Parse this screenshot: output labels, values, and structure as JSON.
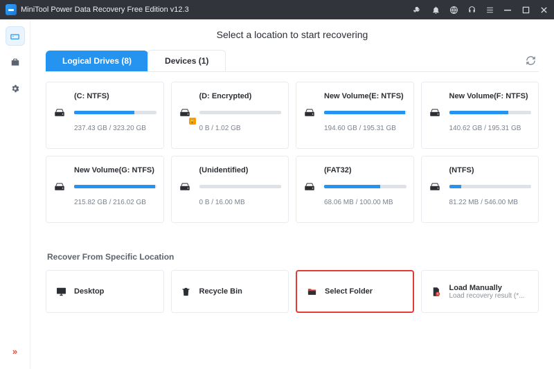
{
  "titlebar": {
    "title": "MiniTool Power Data Recovery Free Edition v12.3"
  },
  "page": {
    "heading": "Select a location to start recovering",
    "section_title": "Recover From Specific Location"
  },
  "tabs": {
    "logical": "Logical Drives (8)",
    "devices": "Devices (1)"
  },
  "drives": [
    {
      "name": "(C: NTFS)",
      "size": "237.43 GB / 323.20 GB",
      "pct": 73,
      "locked": false
    },
    {
      "name": "(D: Encrypted)",
      "size": "0 B / 1.02 GB",
      "pct": 0,
      "locked": true
    },
    {
      "name": "New Volume(E: NTFS)",
      "size": "194.60 GB / 195.31 GB",
      "pct": 99,
      "locked": false
    },
    {
      "name": "New Volume(F: NTFS)",
      "size": "140.62 GB / 195.31 GB",
      "pct": 72,
      "locked": false
    },
    {
      "name": "New Volume(G: NTFS)",
      "size": "215.82 GB / 216.02 GB",
      "pct": 99,
      "locked": false
    },
    {
      "name": "(Unidentified)",
      "size": "0 B / 16.00 MB",
      "pct": 0,
      "locked": false
    },
    {
      "name": "(FAT32)",
      "size": "68.06 MB / 100.00 MB",
      "pct": 68,
      "locked": false
    },
    {
      "name": "(NTFS)",
      "size": "81.22 MB / 546.00 MB",
      "pct": 15,
      "locked": false
    }
  ],
  "locations": {
    "desktop": {
      "label": "Desktop"
    },
    "recycle": {
      "label": "Recycle Bin"
    },
    "folder": {
      "label": "Select Folder"
    },
    "manual": {
      "label": "Load Manually",
      "sub": "Load recovery result (*..."
    }
  }
}
